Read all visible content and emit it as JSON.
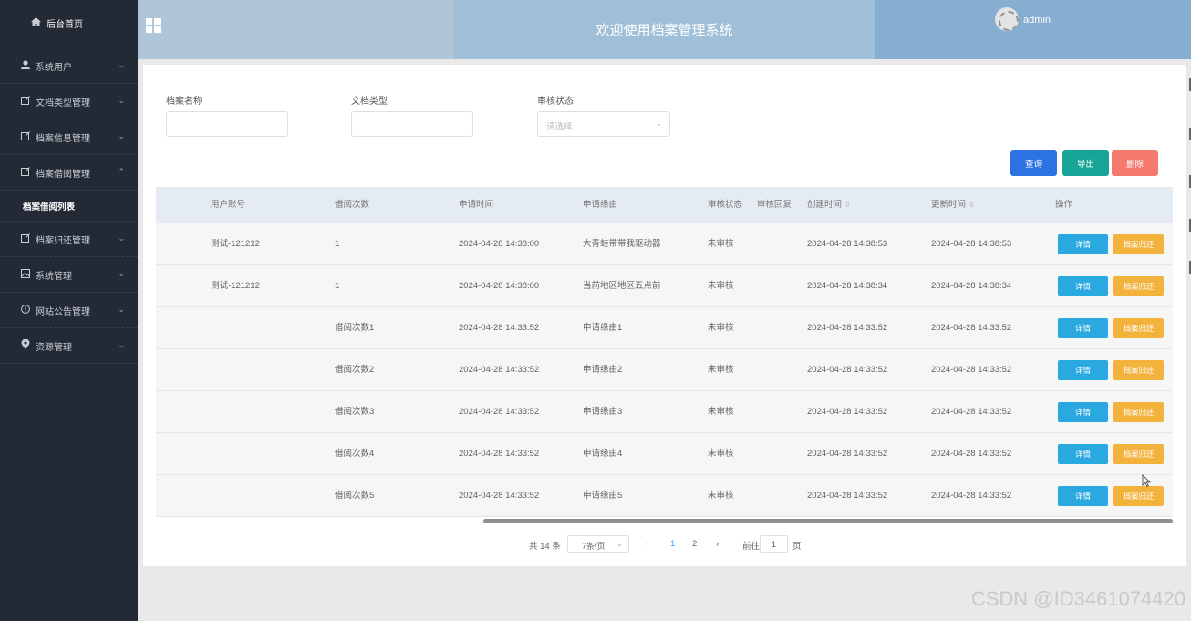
{
  "sidebar": {
    "home": "后台首页",
    "items": [
      {
        "label": "系统用户",
        "chev": "⌄"
      },
      {
        "label": "文档类型管理",
        "chev": "⌄"
      },
      {
        "label": "档案信息管理",
        "chev": "⌄"
      },
      {
        "label": "档案借阅管理",
        "chev": "⌃"
      }
    ],
    "sub_item": "档案借阅列表",
    "items2": [
      {
        "label": "档案归还管理",
        "chev": "⌄"
      },
      {
        "label": "系统管理",
        "chev": "⌄"
      },
      {
        "label": "网站公告管理",
        "chev": "⌄"
      },
      {
        "label": "资源管理",
        "chev": "⌄"
      }
    ]
  },
  "header": {
    "title": "欢迎使用档案管理系统",
    "user": "admin"
  },
  "filters": {
    "name_label": "档案名称",
    "type_label": "文档类型",
    "status_label": "审核状态",
    "status_placeholder": "请选择"
  },
  "buttons": {
    "query": "查询",
    "export": "导出",
    "delete": "删除"
  },
  "table": {
    "headers": [
      "用户账号",
      "借阅次数",
      "申请时间",
      "申请缘由",
      "审核状态",
      "审核回复",
      "创建时间",
      "更新时间",
      "操作"
    ],
    "sort_mark": "⇕",
    "detail_label": "详情",
    "return_label": "档案归还",
    "rows": [
      {
        "account": "测试-121212",
        "count": "1",
        "apply_time": "2024-04-28 14:38:00",
        "reason": "大青蛙带带我驱动器",
        "status": "未审核",
        "reply": "",
        "created": "2024-04-28 14:38:53",
        "updated": "2024-04-28 14:38:53"
      },
      {
        "account": "测试-121212",
        "count": "1",
        "apply_time": "2024-04-28 14:38:00",
        "reason": "当前地区地区五点前",
        "status": "未审核",
        "reply": "",
        "created": "2024-04-28 14:38:34",
        "updated": "2024-04-28 14:38:34"
      },
      {
        "account": "",
        "count": "借阅次数1",
        "apply_time": "2024-04-28 14:33:52",
        "reason": "申请缘由1",
        "status": "未审核",
        "reply": "",
        "created": "2024-04-28 14:33:52",
        "updated": "2024-04-28 14:33:52"
      },
      {
        "account": "",
        "count": "借阅次数2",
        "apply_time": "2024-04-28 14:33:52",
        "reason": "申请缘由2",
        "status": "未审核",
        "reply": "",
        "created": "2024-04-28 14:33:52",
        "updated": "2024-04-28 14:33:52"
      },
      {
        "account": "",
        "count": "借阅次数3",
        "apply_time": "2024-04-28 14:33:52",
        "reason": "申请缘由3",
        "status": "未审核",
        "reply": "",
        "created": "2024-04-28 14:33:52",
        "updated": "2024-04-28 14:33:52"
      },
      {
        "account": "",
        "count": "借阅次数4",
        "apply_time": "2024-04-28 14:33:52",
        "reason": "申请缘由4",
        "status": "未审核",
        "reply": "",
        "created": "2024-04-28 14:33:52",
        "updated": "2024-04-28 14:33:52"
      },
      {
        "account": "",
        "count": "借阅次数5",
        "apply_time": "2024-04-28 14:33:52",
        "reason": "申请缘由5",
        "status": "未审核",
        "reply": "",
        "created": "2024-04-28 14:33:52",
        "updated": "2024-04-28 14:33:52"
      }
    ]
  },
  "pagination": {
    "total": "共 14 条",
    "page_size": "7条/页",
    "prev": "‹",
    "pages": [
      "1",
      "2"
    ],
    "next": "›",
    "goto": "前往",
    "goto_value": "1",
    "page_unit": "页"
  },
  "watermark": "CSDN @ID3461074420",
  "colors": {
    "sidebar_bg": "#232a36",
    "query_btn": "#2d72e3",
    "export_btn": "#18a597",
    "delete_btn": "#f47a6e",
    "detail_btn": "#2aa8e0",
    "return_btn": "#f3b23b",
    "active_page": "#409eff"
  }
}
